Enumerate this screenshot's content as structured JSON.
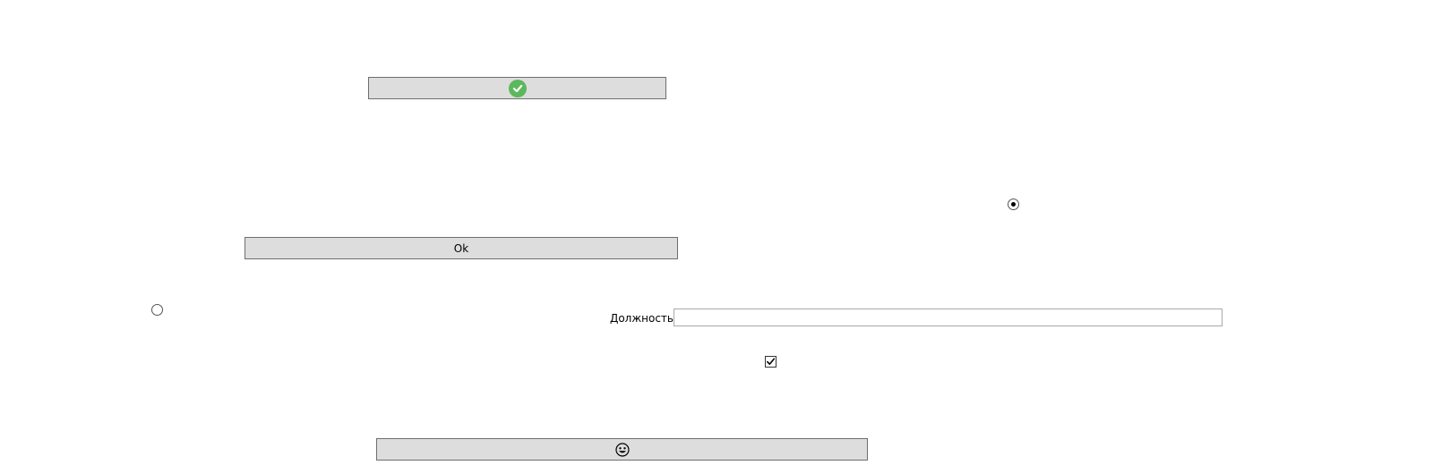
{
  "buttons": {
    "check_icon": "check-circle-icon",
    "ok_label": "Ok",
    "emoji_icon": "smiling-face-icon"
  },
  "position_field": {
    "label": "Должность",
    "value": ""
  },
  "radios": {
    "right_checked": true,
    "left_checked": false
  },
  "checkbox": {
    "checked": true
  },
  "colors": {
    "button_bg": "#dddddd",
    "button_border": "#6e6e6e",
    "check_badge": "#5cb85c"
  }
}
